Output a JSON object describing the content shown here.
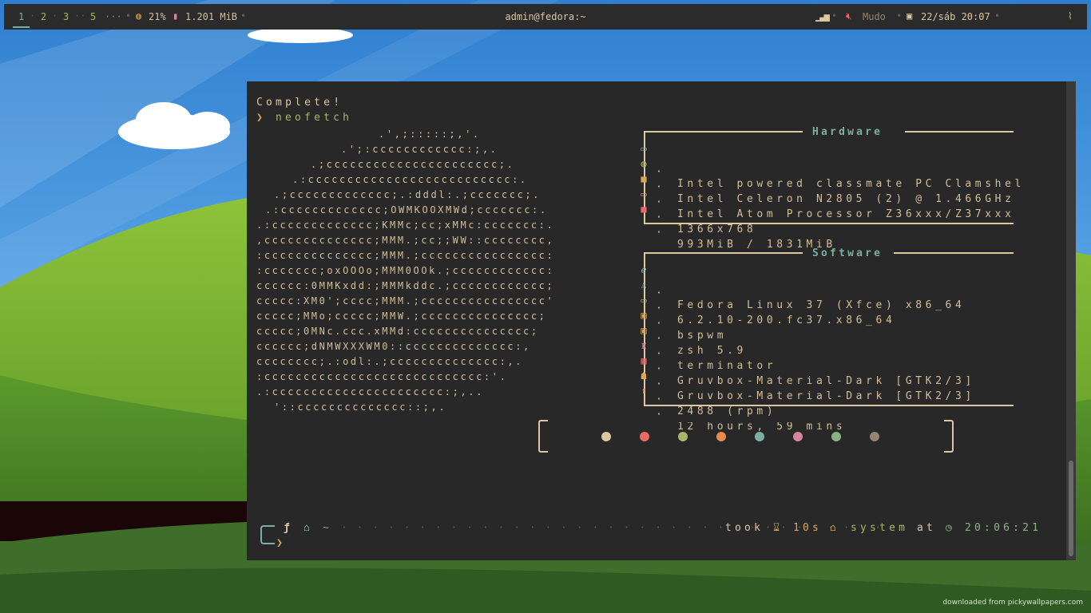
{
  "topbar": {
    "workspaces": [
      "1",
      "2",
      "3",
      "5"
    ],
    "ellipsis": "···",
    "cpu_usage": "21%",
    "memory": "1.201 MiB",
    "window_title": "admin@fedora:~",
    "volume_status": "Mudo",
    "datetime": "22/sáb 20:07"
  },
  "terminal": {
    "prev_output": "Complete!",
    "command_prompt_symbol": "❯",
    "command": "neofetch",
    "ascii_art": [
      ".',;:::::;,'.",
      ".';:cccccccccccc:;,.",
      ".;cccccccccccccccccccccc;.",
      ".:cccccccccccccccccccccccccc:.",
      ".;ccccccccccccc;.:dddl:.;ccccccc;.",
      ".:ccccccccccccc;OWMKOOXMWd;ccccccc:.",
      ".:ccccccccccccc;KMMc;cc;xMMc:ccccccc:.",
      ",cccccccccccccc;MMM.;cc;;WW::cccccccc,",
      ":cccccccccccccc;MMM.;cccccccccccccccc:",
      ":ccccccc;oxOOOo;MMM0OOk.;cccccccccccc:",
      "cccccc:0MMKxdd:;MMMkddc.;cccccccccccc;",
      "ccccc:XM0';cccc;MMM.;cccccccccccccccc'",
      "ccccc;MMo;ccccc;MMW.;ccccccccccccccc;",
      "ccccc;0MNc.ccc.xMMd:ccccccccccccccc;",
      "cccccc;dNMWXXXWM0::cccccccccccccc:,",
      "cccccccc;.:odl:.;cccccccccccccc:,.",
      ":cccccccccccccccccccccccccccc:'.",
      ".:cccccccccccccccccccccc:;,..",
      "'::cccccccccccccc::;,."
    ],
    "hardware": {
      "title": "Hardware",
      "rows": [
        {
          "icon": "laptop-icon",
          "glyph": "▭",
          "color": "#7daea3",
          "value": "Intel powered classmate PC Clamshel"
        },
        {
          "icon": "globe-icon",
          "glyph": "◍",
          "color": "#a9b665",
          "value": "Intel Celeron N2805 (2) @ 1.466GHz"
        },
        {
          "icon": "chip-icon",
          "glyph": "■",
          "color": "#d8a657",
          "value": "Intel Atom Processor Z36xxx/Z37xxx"
        },
        {
          "icon": "monitor-icon",
          "glyph": "▭",
          "color": "#d3869b",
          "value": "1366x768"
        },
        {
          "icon": "memory-icon",
          "glyph": "■",
          "color": "#ea6962",
          "value": "993MiB / 1831MiB"
        }
      ]
    },
    "software": {
      "title": "Software",
      "rows": [
        {
          "icon": "fedora-icon",
          "glyph": "ℯ",
          "color": "#7daea3",
          "value": "Fedora Linux 37 (Xfce) x86_64"
        },
        {
          "icon": "linux-icon",
          "glyph": "♙",
          "color": "#7daea3",
          "value": "6.2.10-200.fc37.x86_64"
        },
        {
          "icon": "window-icon",
          "glyph": "▭",
          "color": "#89b482",
          "value": "bspwm"
        },
        {
          "icon": "shell-icon",
          "glyph": "▣",
          "color": "#d8a657",
          "value": "zsh 5.9"
        },
        {
          "icon": "terminal-icon",
          "glyph": "▣",
          "color": "#d8a657",
          "value": "terminator"
        },
        {
          "icon": "paint-icon",
          "glyph": "♜",
          "color": "#d3869b",
          "value": "Gruvbox-Material-Dark [GTK2/3]"
        },
        {
          "icon": "grid-icon",
          "glyph": "▦",
          "color": "#ea6962",
          "value": "Gruvbox-Material-Dark [GTK2/3]"
        },
        {
          "icon": "fan-icon",
          "glyph": "☗",
          "color": "#d8a657",
          "value": "2488 (rpm)"
        },
        {
          "icon": "uptime-icon",
          "glyph": "⬆",
          "color": "#e78a4e",
          "value": "12 hours, 59 mins"
        }
      ]
    },
    "palette": [
      "#ddc7a1",
      "#ea6962",
      "#a9b665",
      "#e78a4e",
      "#7daea3",
      "#d3869b",
      "#89b482",
      "#928374"
    ],
    "prompt": {
      "path": "~",
      "took_label": "took",
      "duration": "10s",
      "user": "system",
      "at_label": "at",
      "time": "20:06:21",
      "cursor": "❯"
    }
  },
  "watermark": "downloaded from pickywallpapers.com"
}
